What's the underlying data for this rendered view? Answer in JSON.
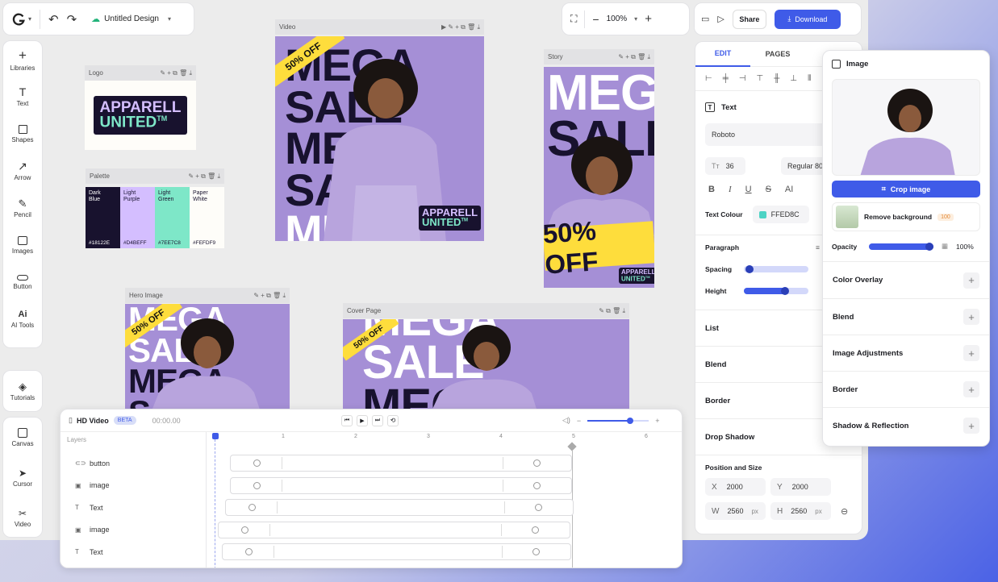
{
  "topbar": {
    "design_title": "Untitled Design",
    "zoom": "100%",
    "share_label": "Share",
    "download_label": "Download"
  },
  "left_toolbar": {
    "tools": [
      "Libraries",
      "Text",
      "Shapes",
      "Arrow",
      "Pencil",
      "Images",
      "Button",
      "AI Tools"
    ],
    "tools2": [
      "Tutorials"
    ],
    "tools3": [
      "Canvas",
      "Cursor",
      "Video"
    ]
  },
  "frames": {
    "logo": {
      "title": "Logo",
      "logo_line1": "APPARELL",
      "logo_line2": "UNITED",
      "tm": "TM"
    },
    "palette": {
      "title": "Palette",
      "swatches": [
        {
          "name": "Dark\nBlue",
          "hex": "#18122E",
          "color": "#18122e",
          "text_color": "#ffffff"
        },
        {
          "name": "Light\nPurple",
          "hex": "#D4BEFF",
          "color": "#d4beff",
          "text_color": "#18122e"
        },
        {
          "name": "Light\nGreen",
          "hex": "#7EE7C8",
          "color": "#7ee7c8",
          "text_color": "#18122e"
        },
        {
          "name": "Paper\nWhite",
          "hex": "#FEFDF9",
          "color": "#fefdf9",
          "text_color": "#18122e"
        }
      ]
    },
    "video": {
      "title": "Video",
      "headline": "MEGA SALE",
      "badge": "50% OFF"
    },
    "story": {
      "title": "Story",
      "line1": "MEGA",
      "line2": "SALE",
      "offer": "50% OFF"
    },
    "hero": {
      "title": "Hero Image",
      "headline": "MEGA SALE",
      "badge": "50% OFF"
    },
    "cover": {
      "title": "Cover Page",
      "headline": "MEGA SALE",
      "badge": "50% OFF"
    }
  },
  "timeline": {
    "title": "HD Video",
    "beta": "BETA",
    "time": "00:00.00",
    "layers_label": "Layers",
    "ruler": [
      "1",
      "2",
      "3",
      "4",
      "5",
      "6"
    ],
    "layers": [
      {
        "label": "button",
        "icon": "link-icon"
      },
      {
        "label": "image",
        "icon": "image-icon"
      },
      {
        "label": "Text",
        "icon": "text-icon"
      },
      {
        "label": "image",
        "icon": "image-icon"
      },
      {
        "label": "Text",
        "icon": "text-icon"
      }
    ]
  },
  "edit_panel": {
    "tabs": [
      "EDIT",
      "PAGES"
    ],
    "text_section": "Text",
    "font": "Roboto",
    "font_size": "36",
    "font_weight": "Regular 80",
    "text_colour_label": "Text Colour",
    "text_colour_hex": "FFED8C",
    "text_colour": "#4dd3c4",
    "paragraph": "Paragraph",
    "spacing": "Spacing",
    "height": "Height",
    "spacing_value": 0.03,
    "height_value": 0.65,
    "sections": [
      "List",
      "Blend",
      "Border",
      "Drop Shadow"
    ],
    "position_label": "Position and Size",
    "x_label": "X",
    "x": "2000",
    "y_label": "Y",
    "y": "2000",
    "w_label": "W",
    "w": "2560",
    "h_label": "H",
    "h": "2560",
    "unit": "px"
  },
  "image_panel": {
    "title": "Image",
    "crop_label": "Crop image",
    "remove_bg_label": "Remove background",
    "remove_bg_cost": "100",
    "opacity_label": "Opacity",
    "opacity_value": "100%",
    "opacity_fraction": 1.0,
    "sections": [
      "Color Overlay",
      "Blend",
      "Image Adjustments",
      "Border",
      "Shadow & Reflection"
    ]
  },
  "colors": {
    "accent": "#3f5be8",
    "purple": "#a58fd6",
    "dark": "#18122e",
    "yellow": "#fedd3c",
    "green": "#7ee7c8"
  }
}
